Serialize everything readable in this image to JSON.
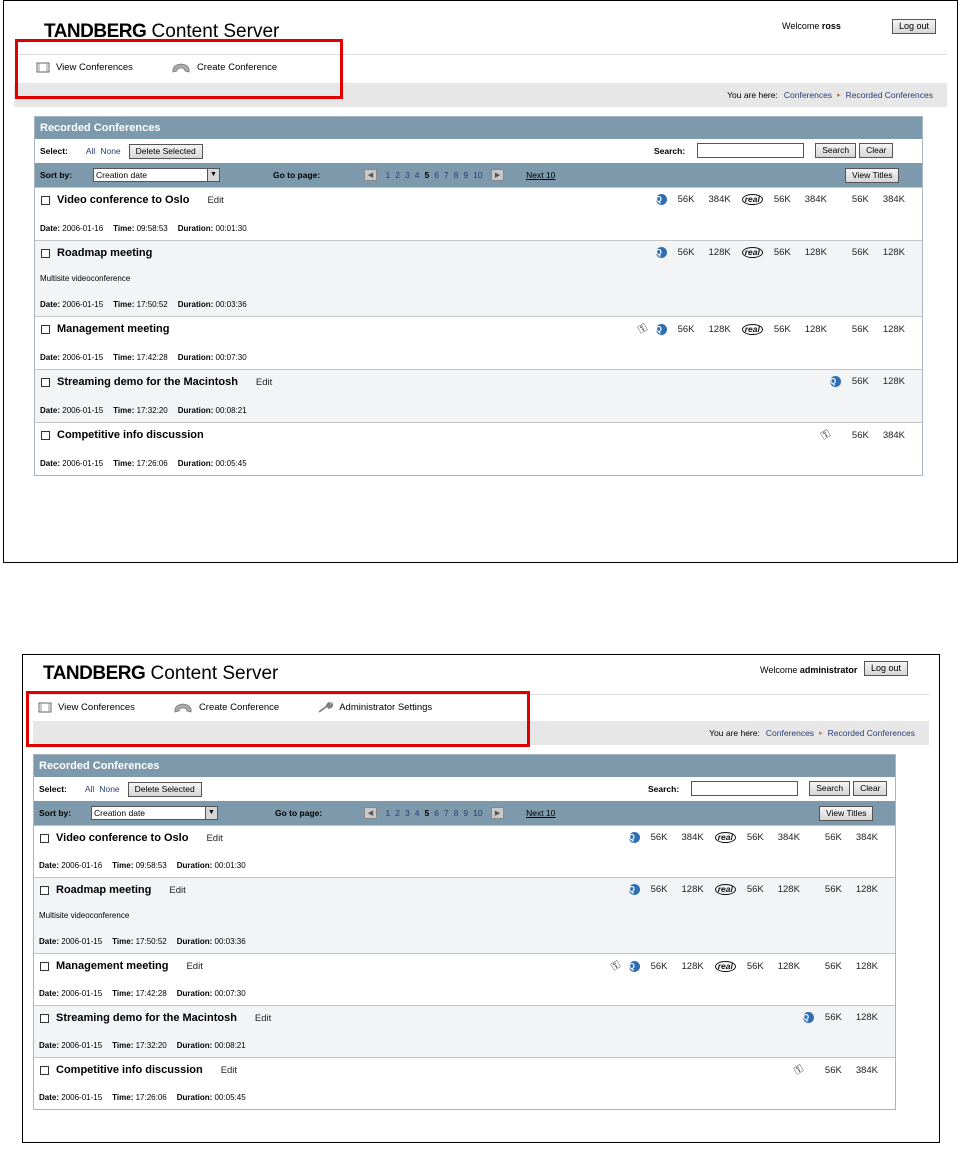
{
  "brand": {
    "bold": "TANDBERG",
    "rest": "Content Server"
  },
  "colors": {
    "highlight": "#e00000",
    "panel_header": "#7c9aab",
    "link": "#2a3c78"
  },
  "screens": [
    {
      "welcome_label": "Welcome",
      "user": "ross",
      "logout_label": "Log out",
      "nav": [
        {
          "label": "View Conferences",
          "icon": "conference-list-icon"
        },
        {
          "label": "Create Conference",
          "icon": "phone-handset-icon"
        }
      ]
    },
    {
      "welcome_label": "Welcome",
      "user": "administrator",
      "logout_label": "Log out",
      "nav": [
        {
          "label": "View Conferences",
          "icon": "conference-list-icon"
        },
        {
          "label": "Create Conference",
          "icon": "phone-handset-icon"
        },
        {
          "label": "Administrator Settings",
          "icon": "wrench-icon"
        }
      ]
    }
  ],
  "breadcrumb": {
    "prefix": "You are here:",
    "items": [
      "Conferences",
      "Recorded Conferences"
    ]
  },
  "panel": {
    "title": "Recorded Conferences",
    "select_label": "Select:",
    "select_all": "All",
    "select_none": "None",
    "delete_label": "Delete Selected",
    "search_label": "Search:",
    "search_value": "",
    "search_button": "Search",
    "clear_button": "Clear",
    "sort_label": "Sort by:",
    "sort_value": "Creation date",
    "goto_label": "Go to page:",
    "pages": [
      "1",
      "2",
      "3",
      "4",
      "5",
      "6",
      "7",
      "8",
      "9",
      "10"
    ],
    "current_page": "5",
    "next_label": "Next 10",
    "view_titles": "View Titles"
  },
  "conference_labels": {
    "date": "Date:",
    "time": "Time:",
    "duration": "Duration:",
    "edit": "Edit"
  },
  "conferences": [
    {
      "title": "Video conference to Oslo",
      "description": "",
      "date": "2006-01-16",
      "time": "09:58:53",
      "duration": "00:01:30",
      "key": false,
      "quicktime": [
        "56K",
        "384K"
      ],
      "real": [
        "56K",
        "384K"
      ],
      "windows": [
        "56K",
        "384K"
      ]
    },
    {
      "title": "Roadmap meeting",
      "description": "Multisite videoconference",
      "date": "2006-01-15",
      "time": "17:50:52",
      "duration": "00:03:36",
      "key": false,
      "quicktime": [
        "56K",
        "128K"
      ],
      "real": [
        "56K",
        "128K"
      ],
      "windows": [
        "56K",
        "128K"
      ]
    },
    {
      "title": "Management meeting",
      "description": "",
      "date": "2006-01-15",
      "time": "17:42:28",
      "duration": "00:07:30",
      "key": true,
      "quicktime": [
        "56K",
        "128K"
      ],
      "real": [
        "56K",
        "128K"
      ],
      "windows": [
        "56K",
        "128K"
      ]
    },
    {
      "title": "Streaming demo for the Macintosh",
      "description": "",
      "date": "2006-01-15",
      "time": "17:32:20",
      "duration": "00:08:21",
      "key": false,
      "quicktime": [
        "56K",
        "128K"
      ],
      "real": [],
      "windows": []
    },
    {
      "title": "Competitive info discussion",
      "description": "",
      "date": "2006-01-15",
      "time": "17:26:06",
      "duration": "00:05:45",
      "key": true,
      "quicktime": [],
      "real": [],
      "windows": [
        "56K",
        "384K"
      ]
    }
  ]
}
